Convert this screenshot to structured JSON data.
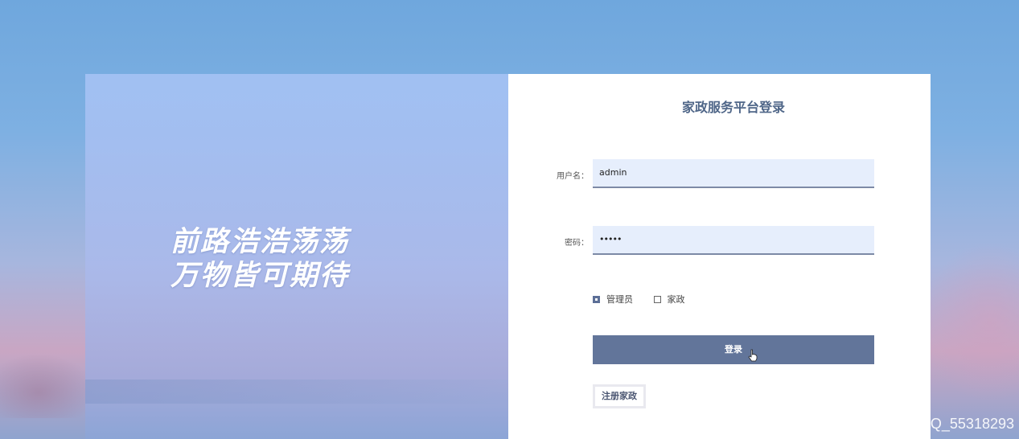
{
  "slogan": {
    "line1": "前路浩浩荡荡",
    "line2": "万物皆可期待"
  },
  "login": {
    "title": "家政服务平台登录",
    "username_label": "用户名：",
    "username_value": "admin",
    "password_label": "密码：",
    "password_value": "•••••",
    "roles": [
      {
        "label": "管理员",
        "checked": true
      },
      {
        "label": "家政",
        "checked": false
      }
    ],
    "login_button": "登录",
    "register_button": "注册家政"
  },
  "watermark": "CSDN @Q_55318293",
  "colors": {
    "button": "#62759a",
    "input_bg": "#e6eefc",
    "title": "#4f6688"
  }
}
